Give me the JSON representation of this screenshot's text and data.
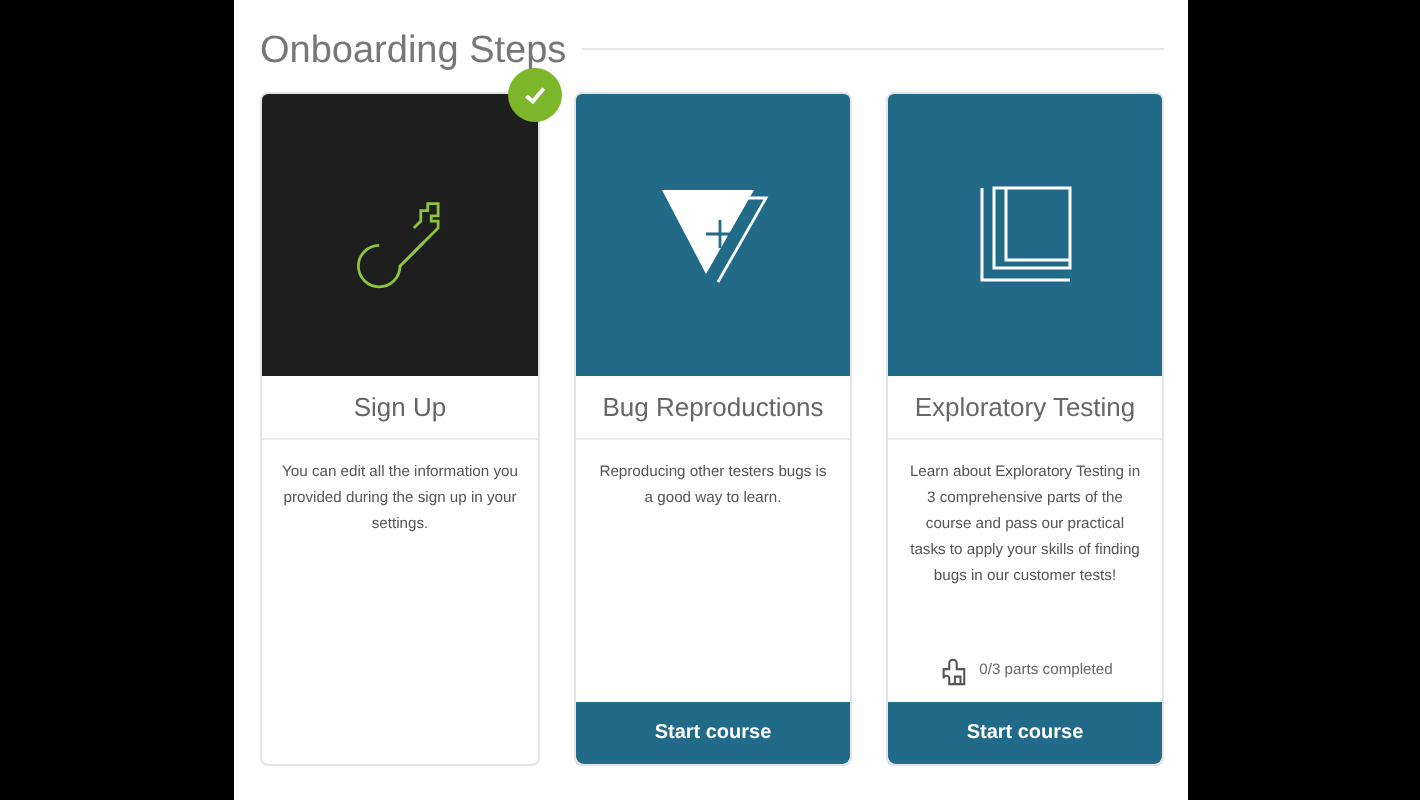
{
  "section_title": "Onboarding Steps",
  "steps": [
    {
      "title": "Sign Up",
      "completed": true,
      "description": "You can edit all the information you provided during the sign up in your settings."
    },
    {
      "title": "Bug Reproductions",
      "completed": false,
      "description": "Reproducing other testers bugs is a good way to learn.",
      "button": "Start course"
    },
    {
      "title": "Exploratory Testing",
      "completed": false,
      "description": "Learn about Exploratory Testing in 3 comprehensive parts of the course and pass our practical tasks to apply your skills of finding bugs in our customer tests!",
      "progress": "0/3 parts completed",
      "button": "Start course"
    }
  ]
}
